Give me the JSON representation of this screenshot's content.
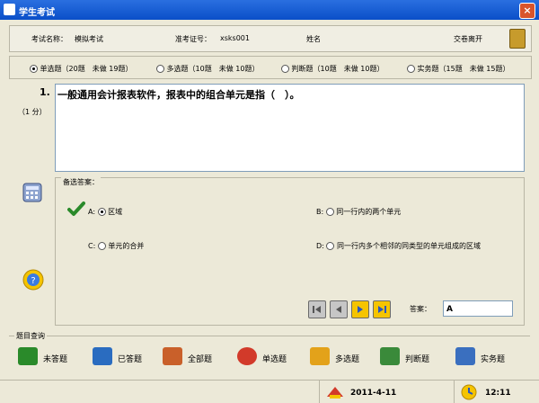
{
  "window": {
    "title": "学生考试",
    "close_label": "×"
  },
  "info": {
    "exam_name_label": "考试名称：",
    "exam_name_value": "模拟考试",
    "ticket_label": "准考证号：",
    "ticket_value": "xsks001",
    "name_label": "姓名",
    "submit_label": "交卷离开"
  },
  "question_types": [
    {
      "label": "单选题（20题　未做 19题）",
      "selected": true
    },
    {
      "label": "多选题（10题　未做 10题）",
      "selected": false
    },
    {
      "label": "判断题（10题　未做 10题）",
      "selected": false
    },
    {
      "label": "实务题（15题　未做 15题）",
      "selected": false
    }
  ],
  "question": {
    "number": "1.",
    "score": "（1 分）",
    "text": "一般通用会计报表软件，报表中的组合单元是指（　）。"
  },
  "options": {
    "legend": "备选答案：",
    "items": [
      {
        "key": "A:",
        "text": "区域",
        "selected": true
      },
      {
        "key": "B:",
        "text": "同一行内的两个单元",
        "selected": false
      },
      {
        "key": "C:",
        "text": "单元的合并",
        "selected": false
      },
      {
        "key": "D:",
        "text": "同一行内多个相邻的同类型的单元组成的区域",
        "selected": false
      }
    ]
  },
  "answer": {
    "label": "答案：",
    "value": "A"
  },
  "query": {
    "legend": "题目查询",
    "buttons": [
      {
        "label": "未答题",
        "icon": "unanswered-icon",
        "color": "#2a8a2a"
      },
      {
        "label": "已答题",
        "icon": "answered-icon",
        "color": "#2a6cc0"
      },
      {
        "label": "全部题",
        "icon": "all-questions-icon",
        "color": "#c9602a"
      },
      {
        "label": "单选题",
        "icon": "single-choice-icon",
        "color": "#d23a2a"
      },
      {
        "label": "多选题",
        "icon": "multi-choice-icon",
        "color": "#e3a21a"
      },
      {
        "label": "判断题",
        "icon": "judgment-icon",
        "color": "#3a8a3a"
      },
      {
        "label": "实务题",
        "icon": "practical-icon",
        "color": "#3a6fbf"
      }
    ]
  },
  "status": {
    "date": "2011-4-11",
    "time": "12:11"
  },
  "colors": {
    "titlebar": "#0a4fc8",
    "accent_nav": "#f5c400",
    "nav_gray": "#a8a8a8"
  }
}
